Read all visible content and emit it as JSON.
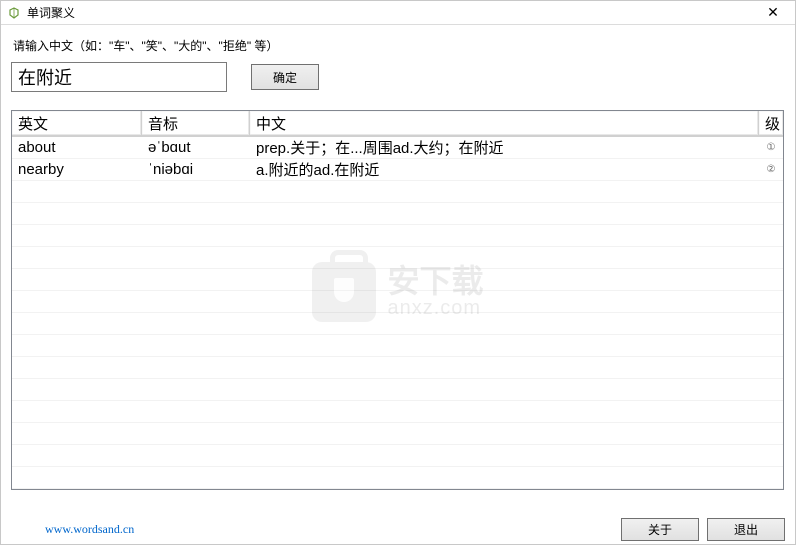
{
  "window": {
    "title": "单词聚义",
    "close_label": "✕"
  },
  "prompt": "请输入中文（如：\"车\"、\"笑\"、\"大的\"、\"拒绝\"  等）",
  "input": {
    "value": "在附近"
  },
  "buttons": {
    "ok": "确定",
    "about": "关于",
    "exit": "退出"
  },
  "table": {
    "headers": {
      "english": "英文",
      "phonetic": "音标",
      "chinese": "中文",
      "level": "级"
    },
    "rows": [
      {
        "english": "about",
        "phonetic": "əˈbɑut",
        "chinese": "prep.关于；在...周围ad.大约；在附近",
        "level": "①"
      },
      {
        "english": "nearby",
        "phonetic": "ˈniəbɑi",
        "chinese": "a.附近的ad.在附近",
        "level": "②"
      }
    ]
  },
  "link": {
    "text": "www.wordsand.cn"
  },
  "watermark": {
    "main": "安下载",
    "sub": "anxz.com"
  }
}
